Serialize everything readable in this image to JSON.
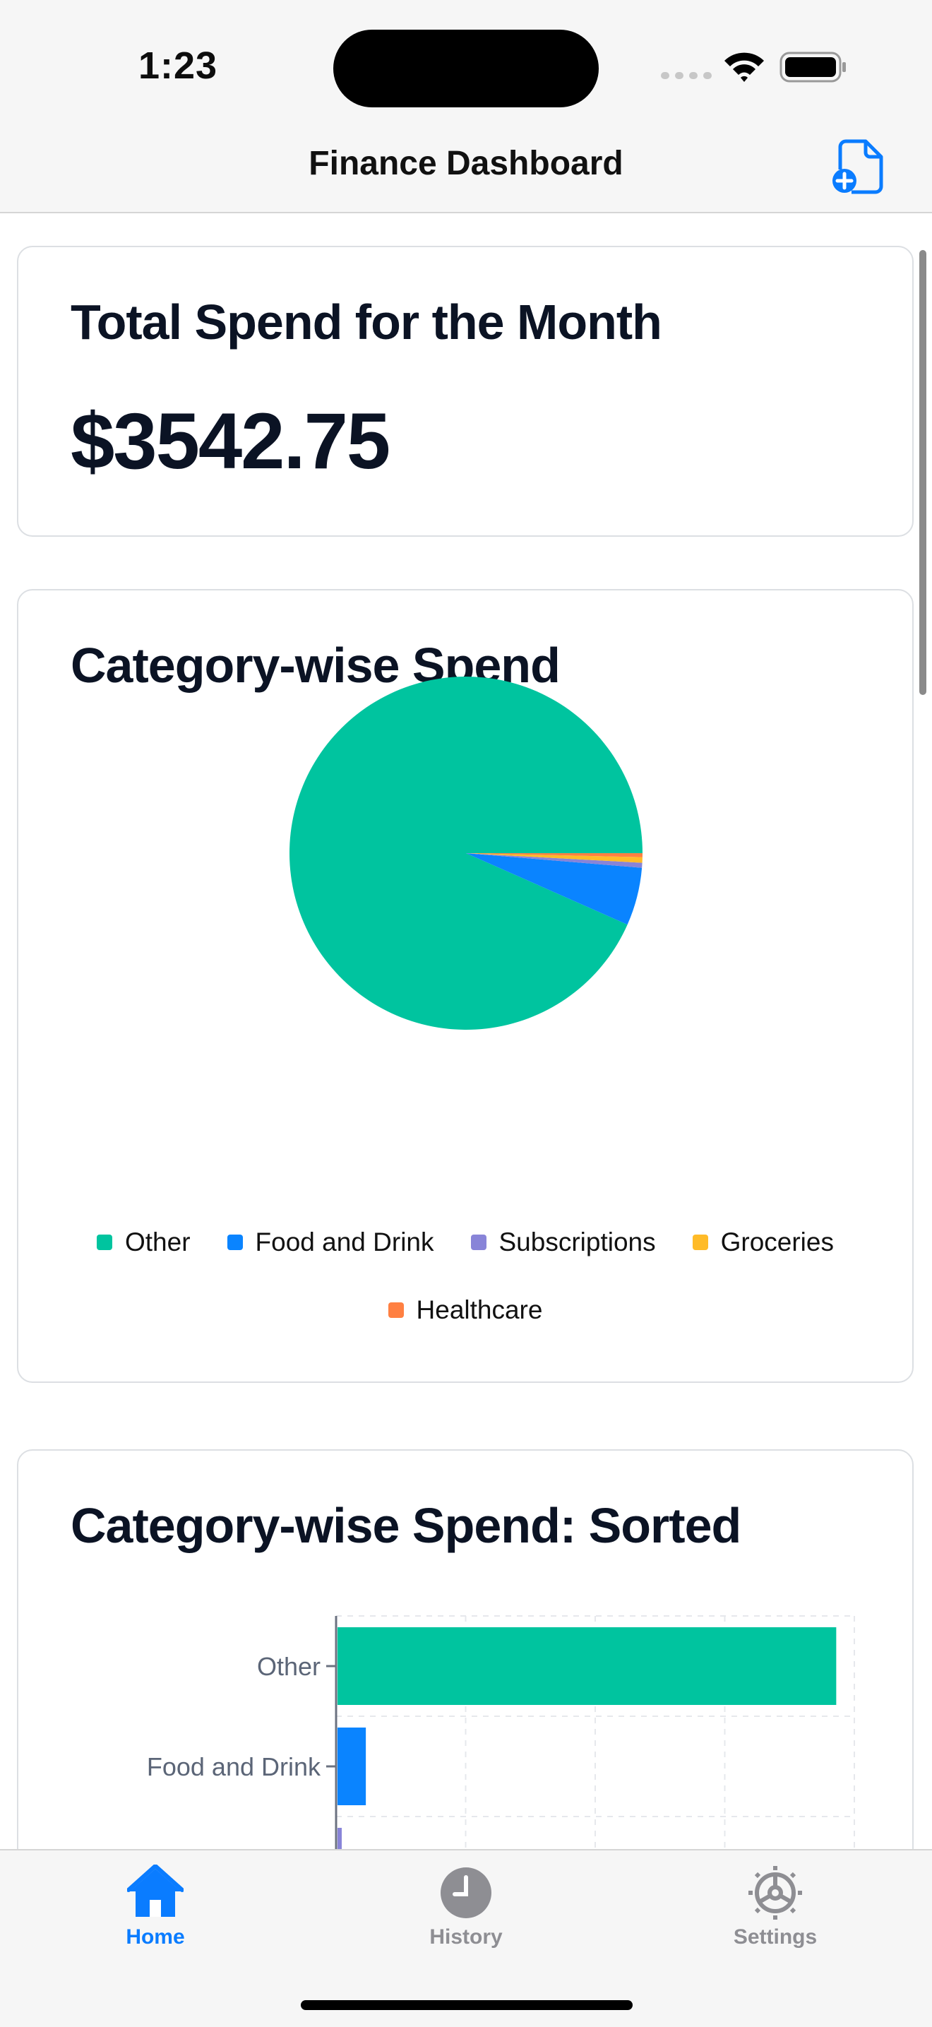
{
  "status": {
    "time": "1:23"
  },
  "nav": {
    "title": "Finance Dashboard",
    "new_doc_icon": "doc-plus-icon"
  },
  "total_card": {
    "title": "Total Spend for the Month",
    "amount": "$3542.75"
  },
  "pie_card": {
    "title": "Category-wise Spend"
  },
  "bar_card": {
    "title": "Category-wise Spend: Sorted"
  },
  "colors": {
    "accent": "#0a7cff",
    "other": "#00c49f",
    "food": "#0a84ff",
    "subscriptions": "#8884d8",
    "groceries": "#ffbb28",
    "healthcare": "#ff8042"
  },
  "chart_data": [
    {
      "type": "pie",
      "title": "Category-wise Spend",
      "categories": [
        "Other",
        "Food and Drink",
        "Subscriptions",
        "Groceries",
        "Healthcare"
      ],
      "values": [
        3308.0,
        188.0,
        16.0,
        18.0,
        12.75
      ],
      "colors": [
        "#00c49f",
        "#0a84ff",
        "#8884d8",
        "#ffbb28",
        "#ff8042"
      ],
      "legend_position": "bottom"
    },
    {
      "type": "bar",
      "orientation": "horizontal",
      "title": "Category-wise Spend: Sorted",
      "categories": [
        "Other",
        "Food and Drink",
        "Subscriptions"
      ],
      "values": [
        3308.0,
        188.0,
        16.0
      ],
      "colors": [
        "#00c49f",
        "#0a84ff",
        "#8884d8"
      ],
      "grid": true
    }
  ],
  "tabs": [
    {
      "label": "Home",
      "icon": "house-icon",
      "active": true
    },
    {
      "label": "History",
      "icon": "clock-icon",
      "active": false
    },
    {
      "label": "Settings",
      "icon": "gear-icon",
      "active": false
    }
  ]
}
